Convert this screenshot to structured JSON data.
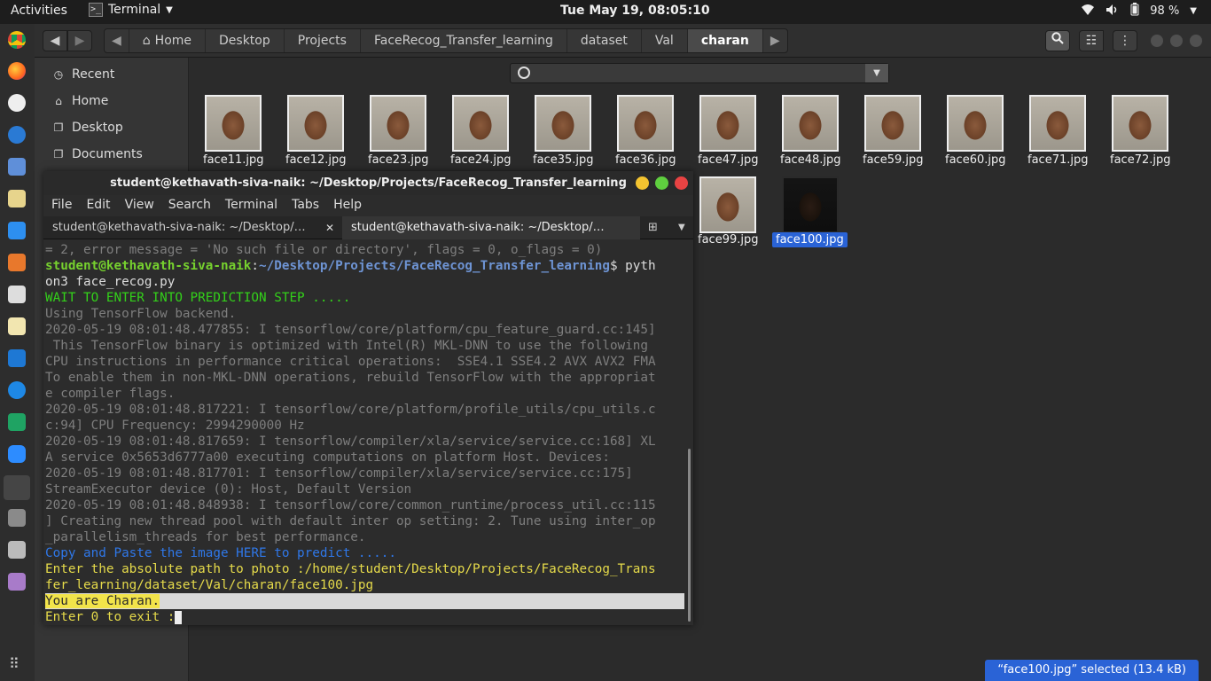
{
  "topbar": {
    "activities": "Activities",
    "app_name": "Terminal",
    "clock": "Tue May 19, 08:05:10",
    "battery": "98 %"
  },
  "file_manager": {
    "breadcrumbs": [
      "Home",
      "Desktop",
      "Projects",
      "FaceRecog_Transfer_learning",
      "dataset",
      "Val",
      "charan"
    ],
    "sidebar": [
      "Recent",
      "Home",
      "Desktop",
      "Documents"
    ],
    "files": [
      {
        "name": "face11.jpg"
      },
      {
        "name": "face12.jpg"
      },
      {
        "name": "face23.jpg"
      },
      {
        "name": "face24.jpg"
      },
      {
        "name": "face35.jpg"
      },
      {
        "name": "face36.jpg"
      },
      {
        "name": "face47.jpg"
      },
      {
        "name": "face48.jpg"
      },
      {
        "name": "face59.jpg"
      },
      {
        "name": "face60.jpg"
      },
      {
        "name": "face71.jpg"
      },
      {
        "name": "face72.jpg"
      },
      {
        "name": "face99.jpg"
      },
      {
        "name": "face100.jpg"
      }
    ],
    "status": "“face100.jpg” selected  (13.4 kB)"
  },
  "terminal": {
    "title": "student@kethavath-siva-naik: ~/Desktop/Projects/FaceRecog_Transfer_learning",
    "menu": [
      "File",
      "Edit",
      "View",
      "Search",
      "Terminal",
      "Tabs",
      "Help"
    ],
    "tabs": [
      "student@kethavath-siva-naik: ~/Desktop/…",
      "student@kethavath-siva-naik: ~/Desktop/…"
    ],
    "lines": {
      "l1": "= 2, error message = 'No such file or directory', flags = 0, o_flags = 0)",
      "l2_user": "student@kethavath-siva-naik",
      "l2_path": "~/Desktop/Projects/FaceRecog_Transfer_learning",
      "l2_cmd": "$ pyth",
      "l3": "on3 face_recog.py",
      "l4": "WAIT TO ENTER INTO PREDICTION STEP .....",
      "l5": "Using TensorFlow backend.",
      "l6": "2020-05-19 08:01:48.477855: I tensorflow/core/platform/cpu_feature_guard.cc:145]",
      "l7": " This TensorFlow binary is optimized with Intel(R) MKL-DNN to use the following",
      "l8": "CPU instructions in performance critical operations:  SSE4.1 SSE4.2 AVX AVX2 FMA",
      "l9": "To enable them in non-MKL-DNN operations, rebuild TensorFlow with the appropriat",
      "l10": "e compiler flags.",
      "l11": "2020-05-19 08:01:48.817221: I tensorflow/core/platform/profile_utils/cpu_utils.c",
      "l12": "c:94] CPU Frequency: 2994290000 Hz",
      "l13": "2020-05-19 08:01:48.817659: I tensorflow/compiler/xla/service/service.cc:168] XL",
      "l14": "A service 0x5653d6777a00 executing computations on platform Host. Devices:",
      "l15": "2020-05-19 08:01:48.817701: I tensorflow/compiler/xla/service/service.cc:175]",
      "l16": "StreamExecutor device (0): Host, Default Version",
      "l17": "2020-05-19 08:01:48.848938: I tensorflow/core/common_runtime/process_util.cc:115",
      "l18": "] Creating new thread pool with default inter op setting: 2. Tune using inter_op",
      "l19": "_parallelism_threads for best performance.",
      "l20": "Copy and Paste the image HERE to predict .....",
      "l21": "Enter the absolute path to photo :/home/student/Desktop/Projects/FaceRecog_Trans",
      "l22": "fer_learning/dataset/Val/charan/face100.jpg",
      "l23": "You are Charan.",
      "l24": "Enter 0 to exit :"
    }
  }
}
